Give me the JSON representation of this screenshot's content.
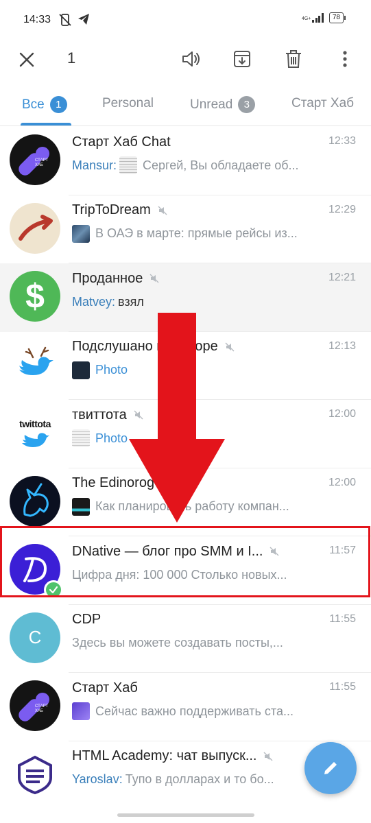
{
  "status": {
    "time": "14:33",
    "network": "4G+",
    "battery": "78"
  },
  "actionbar": {
    "selected_count": "1"
  },
  "tabs": [
    {
      "label": "Все",
      "badge": "1"
    },
    {
      "label": "Personal"
    },
    {
      "label": "Unread",
      "badge": "3"
    },
    {
      "label": "Старт Хаб"
    }
  ],
  "chats": [
    {
      "name": "Старт Хаб Chat",
      "time": "12:33",
      "sender": "Mansur:",
      "message": "Сергей, Вы обладаете об..."
    },
    {
      "name": "TripToDream",
      "time": "12:29",
      "message": "В ОАЭ в марте: прямые рейсы из..."
    },
    {
      "name": "Проданное",
      "time": "12:21",
      "sender": "Matvey:",
      "message": "взял"
    },
    {
      "name": "Подслушано в твиторе",
      "time": "12:13",
      "message": "Photo"
    },
    {
      "name": "твиттота",
      "time": "12:00",
      "message": "Photo"
    },
    {
      "name": "The Edinorog",
      "time": "12:00",
      "message": "Как планировать работу компан..."
    },
    {
      "name": "DNative — блог про SMM и I...",
      "time": "11:57",
      "message": "Цифра дня: 100 000   Столько новых..."
    },
    {
      "name": "CDP",
      "time": "11:55",
      "message": "Здесь вы можете создавать посты,..."
    },
    {
      "name": "Старт Хаб",
      "time": "11:55",
      "message": "Сейчас важно поддерживать ста..."
    },
    {
      "name": "HTML Academy: чат выпуск...",
      "time": "",
      "sender": "Yaroslav:",
      "message": "Тупо в долларах и то бо..."
    }
  ],
  "avatars": {
    "start_hub_text": "СТАРТ ХАБ",
    "twittota_text": "twittota",
    "cdp_letter": "C"
  },
  "colors": {
    "accent": "#3a8fd6",
    "annotation_red": "#e3141b",
    "fab": "#5aa6e6"
  }
}
